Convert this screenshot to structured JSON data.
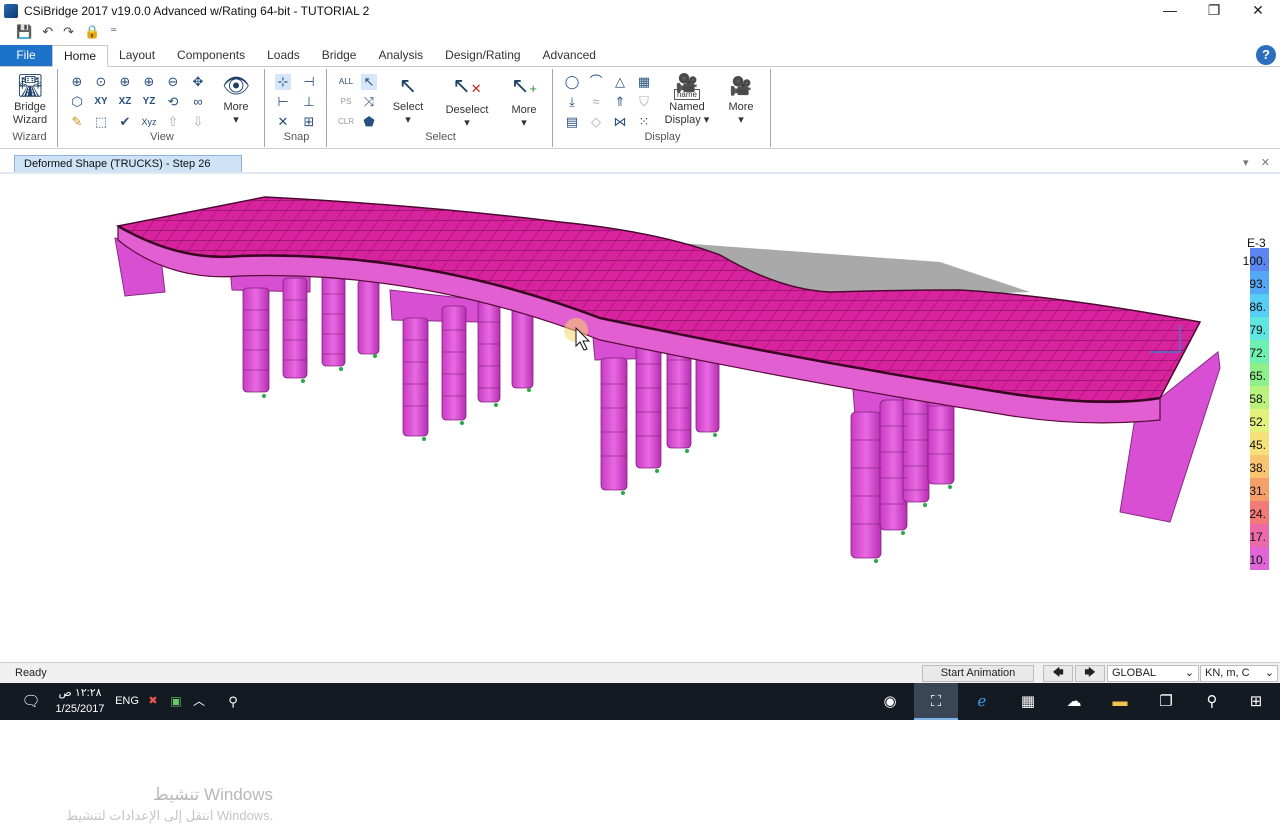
{
  "window": {
    "title": "CSiBridge 2017 v19.0.0 Advanced w/Rating 64-bit - TUTORIAL 2",
    "minimize": "—",
    "restore": "❐",
    "close": "✕"
  },
  "quick_access": {
    "save": "💾",
    "undo": "↶",
    "redo": "↷",
    "lock": "🔒",
    "customize": "⁼"
  },
  "menu": {
    "file": "File",
    "tabs": [
      "Home",
      "Layout",
      "Components",
      "Loads",
      "Bridge",
      "Analysis",
      "Design/Rating",
      "Advanced"
    ],
    "active_tab": "Home",
    "help": "?"
  },
  "ribbon": {
    "bridge_wizard": {
      "label_1": "Bridge",
      "label_2": "Wizard",
      "group": "Wizard"
    },
    "view": {
      "more": "More",
      "group": "View",
      "xy": "XY",
      "xz": "XZ",
      "yz": "YZ",
      "xyz": "Xyz"
    },
    "snap": {
      "group": "Snap"
    },
    "select": {
      "all": "ALL",
      "ps": "PS",
      "clr": "CLR",
      "select": "Select",
      "deselect": "Deselect",
      "more": "More",
      "group": "Select"
    },
    "display": {
      "named_1": "Named",
      "named_2": "Display",
      "name_tag": "name",
      "more": "More",
      "group": "Display"
    }
  },
  "document_tab": {
    "title": "Deformed Shape (TRUCKS) - Step 26"
  },
  "legend": {
    "unit": "E-3",
    "labels": [
      "100.",
      "93.",
      "86.",
      "79.",
      "72.",
      "65.",
      "58.",
      "52.",
      "45.",
      "38.",
      "31.",
      "24.",
      "17.",
      "10."
    ],
    "colors": [
      "#5e86f0",
      "#55a8f6",
      "#55cdf4",
      "#5fe6e0",
      "#6ef0b0",
      "#8ef08a",
      "#b9f27c",
      "#e3f27a",
      "#f6e07a",
      "#f7c470",
      "#f5a06a",
      "#f27a77",
      "#ec6aa8",
      "#e066d8"
    ]
  },
  "watermark": {
    "line1": "تنشيط Windows",
    "line2": "انتقل إلى الإعدادات لتنشيط Windows."
  },
  "status": {
    "text": "Ready",
    "start_animation": "Start Animation",
    "coord_system": "GLOBAL",
    "units": "KN, m, C"
  },
  "taskbar": {
    "time": "١٢:٢٨ ص",
    "date": "1/25/2017",
    "language": "ENG"
  },
  "colors": {
    "deck": "#d9239e",
    "deck_grid": "#5a0b3a",
    "piers": "#e04fd8",
    "ribbon_accent": "#1c73c9"
  }
}
